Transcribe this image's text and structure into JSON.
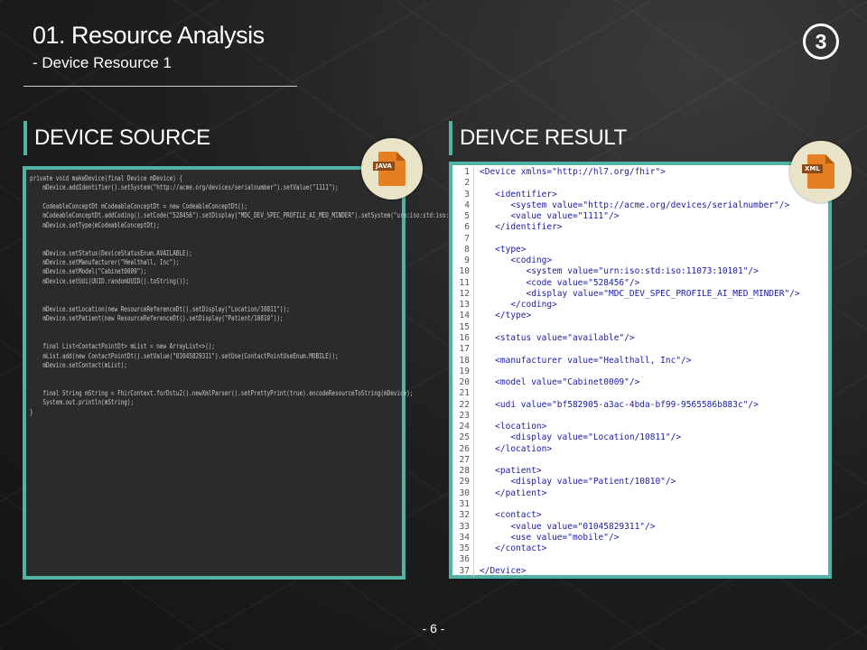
{
  "slide": {
    "title": "01. Resource Analysis",
    "subtitle": "- Device Resource 1",
    "page_badge": "3",
    "footer": "- 6 -"
  },
  "sections": {
    "source": {
      "heading": "DEVICE SOURCE",
      "icon_label": "JAVA",
      "icon": "java-file-icon"
    },
    "result": {
      "heading": "DEIVCE RESULT",
      "icon_label": "XML",
      "icon": "xml-file-icon"
    }
  },
  "colors": {
    "accent": "#4fb3a6",
    "icon_orange": "#e67e22",
    "icon_bg": "#e9e4c8"
  },
  "source_code": [
    "private void makeDevice(final Device mDevice) {",
    "    mDevice.addIdentifier().setSystem(\"http://acme.org/devices/serialnumber\").setValue(\"1111\");",
    "",
    "    CodeableConceptDt mCodeableConceptDt = new CodeableConceptDt();",
    "    mCodeableConceptDt.addCoding().setCode(\"528456\").setDisplay(\"MDC_DEV_SPEC_PROFILE_AI_MED_MINDER\").setSystem(\"urn:iso:std:iso:11073:10101\");",
    "    mDevice.setType(mCodeableConceptDt);",
    "",
    "",
    "    mDevice.setStatus(DeviceStatusEnum.AVAILABLE);",
    "    mDevice.setManufacturer(\"Healthall, Inc\");",
    "    mDevice.setModel(\"Cabinet0009\");",
    "    mDevice.setUdi(UUID.randomUUID().toString());",
    "",
    "",
    "    mDevice.setLocation(new ResourceReferenceDt().setDisplay(\"Location/10811\"));",
    "    mDevice.setPatient(new ResourceReferenceDt().setDisplay(\"Patient/10810\"));",
    "",
    "",
    "    final List<ContactPointDt> mList = new ArrayList<>();",
    "    mList.add(new ContactPointDt().setValue(\"01045829311\").setUse(ContactPointUseEnum.MOBILE));",
    "    mDevice.setContact(mList);",
    "",
    "",
    "    final String mString = FhirContext.forDstu2().newXmlParser().setPrettyPrint(true).encodeResourceToString(mDevice);",
    "    System.out.println(mString);",
    "}"
  ],
  "result_code": [
    "<Device xmlns=\"http://hl7.org/fhir\">",
    "",
    "   <identifier>",
    "      <system value=\"http://acme.org/devices/serialnumber\"/>",
    "      <value value=\"1111\"/>",
    "   </identifier>",
    "",
    "   <type>",
    "      <coding>",
    "         <system value=\"urn:iso:std:iso:11073:10101\"/>",
    "         <code value=\"528456\"/>",
    "         <display value=\"MDC_DEV_SPEC_PROFILE_AI_MED_MINDER\"/>",
    "      </coding>",
    "   </type>",
    "",
    "   <status value=\"available\"/>",
    "",
    "   <manufacturer value=\"Healthall, Inc\"/>",
    "",
    "   <model value=\"Cabinet0009\"/>",
    "",
    "   <udi value=\"bf582905-a3ac-4bda-bf99-9565586b883c\"/>",
    "",
    "   <location>",
    "      <display value=\"Location/10811\"/>",
    "   </location>",
    "",
    "   <patient>",
    "      <display value=\"Patient/10810\"/>",
    "   </patient>",
    "",
    "   <contact>",
    "      <value value=\"01045829311\"/>",
    "      <use value=\"mobile\"/>",
    "   </contact>",
    "",
    "</Device>"
  ]
}
